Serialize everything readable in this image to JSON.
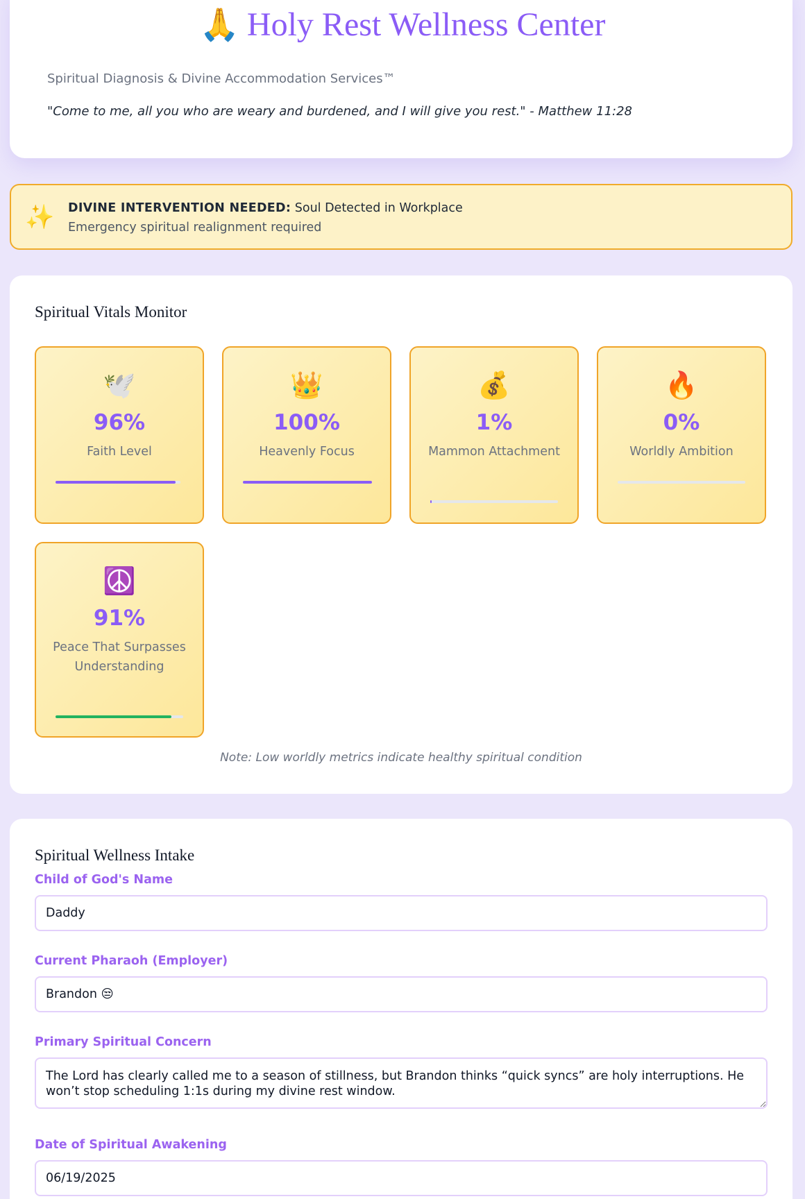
{
  "header": {
    "icon": "folded-hands",
    "title": "Holy Rest Wellness Center",
    "subtitle": "Spiritual Diagnosis & Divine Accommodation Services™",
    "verse": "\"Come to me, all you who are weary and burdened, and I will give you rest.\" - Matthew 11:28"
  },
  "alert": {
    "icon": "sparkles",
    "heading": "DIVINE INTERVENTION NEEDED:",
    "message": " Soul Detected in Workplace",
    "detail": "Emergency spiritual realignment required"
  },
  "vitals": {
    "title": "Spiritual Vitals Monitor",
    "metrics": [
      {
        "icon": "🕊️",
        "value": "96%",
        "label": "Faith Level",
        "level": 0.96,
        "color": "#8b5cf6"
      },
      {
        "icon": "👑",
        "value": "100%",
        "label": "Heavenly Focus",
        "level": 1.0,
        "color": "#8b5cf6"
      },
      {
        "icon": "💰",
        "value": "1%",
        "label": "Mammon Attachment",
        "level": 0.01,
        "color": "#8b5cf6"
      },
      {
        "icon": "🔥",
        "value": "0%",
        "label": "Worldly Ambition",
        "level": 0.0,
        "color": "#8b5cf6"
      },
      {
        "icon": "☮️",
        "value": "91%",
        "label": "Peace That Surpasses Understanding",
        "level": 0.91,
        "color": "#22b35f"
      }
    ],
    "note": "Note: Low worldly metrics indicate healthy spiritual condition"
  },
  "intake": {
    "title": "Spiritual Wellness Intake",
    "name_label": "Child of God's Name",
    "name_value": "Daddy",
    "employer_label": "Current Pharaoh (Employer)",
    "employer_value": "Brandon 😒",
    "concern_label": "Primary Spiritual Concern",
    "concern_value": "The Lord has clearly called me to a season of stillness, but Brandon thinks “quick syncs” are holy interruptions. He won’t stop scheduling 1:1s during my divine rest window.",
    "date_label": "Date of Spiritual Awakening",
    "date_value": "06/19/2025"
  }
}
